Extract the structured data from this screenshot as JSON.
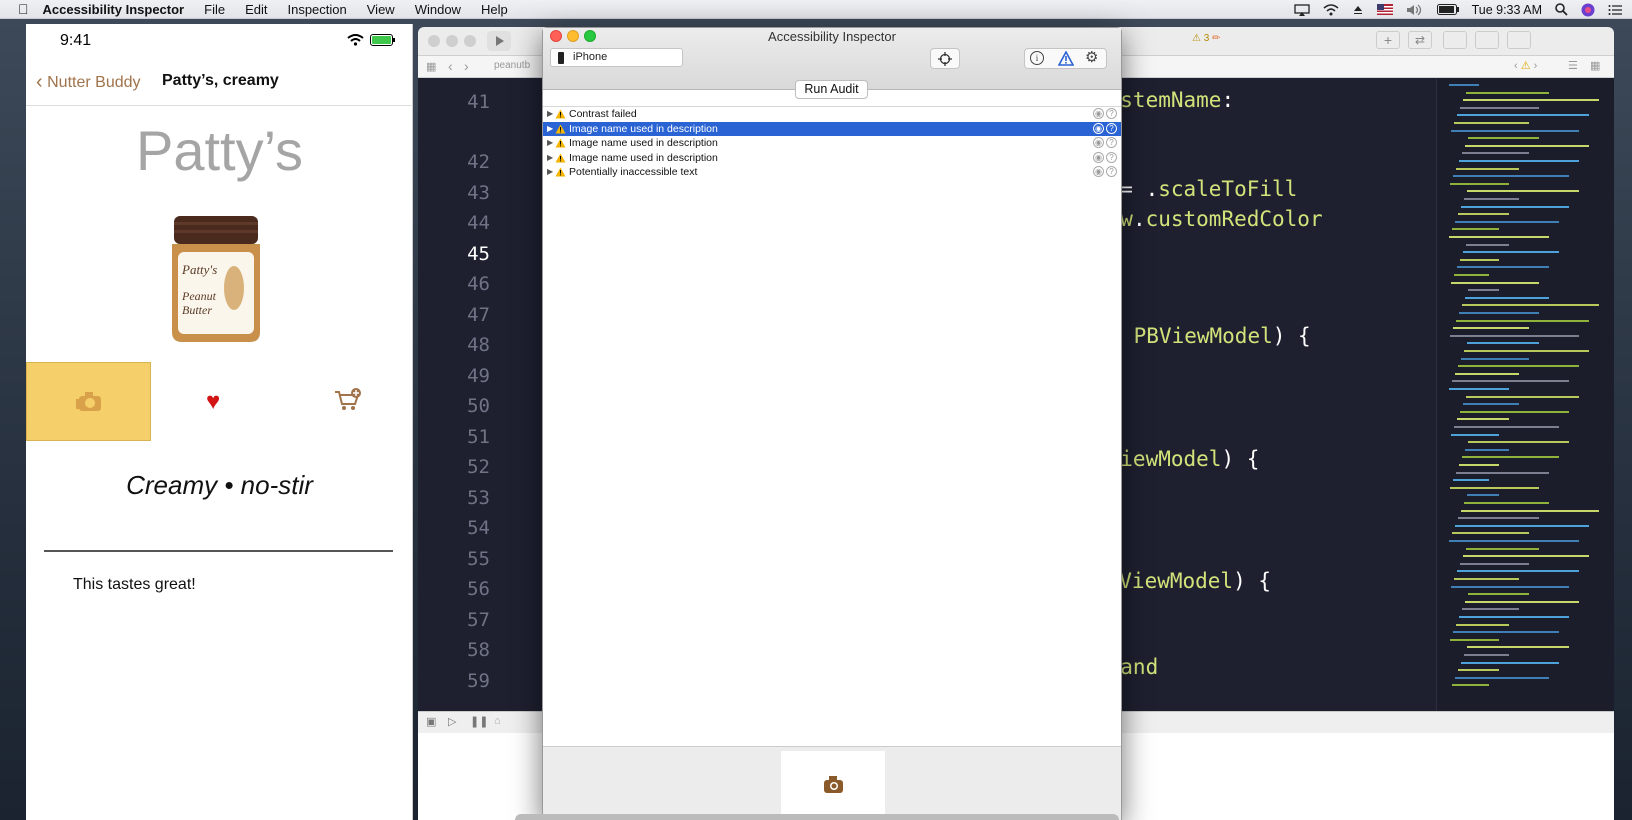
{
  "menubar": {
    "app_name": "Accessibility Inspector",
    "menus": [
      "File",
      "Edit",
      "Inspection",
      "View",
      "Window",
      "Help"
    ],
    "clock": "Tue 9:33 AM"
  },
  "phone": {
    "time": "9:41",
    "back_label": "Nutter Buddy",
    "nav_title": "Patty’s, creamy",
    "brand": "Patty’s",
    "jar_label_lines": [
      "Patty's",
      "Peanut",
      "Butter"
    ],
    "description": "Creamy • no-stir",
    "review": "This tastes great!"
  },
  "xcode": {
    "warning_count": "3",
    "jump_label": "peanutb",
    "line_numbers": [
      "41",
      "",
      "42",
      "43",
      "44",
      "45",
      "46",
      "47",
      "48",
      "49",
      "50",
      "51",
      "52",
      "53",
      "54",
      "55",
      "56",
      "57",
      "58",
      "59"
    ],
    "current_line": "45",
    "code_lines": [
      {
        "text": "systemName:"
      },
      {
        "text": "e = .scaleToFill"
      },
      {
        "text": "iew.customRedColor"
      },
      {
        "text": " PBViewModel) {"
      },
      {
        "text": "BViewModel) {"
      },
      {
        "text": "PBViewModel) {"
      },
      {
        "text": "brand"
      }
    ]
  },
  "inspector": {
    "title": "Accessibility Inspector",
    "device": "iPhone",
    "run_audit": "Run Audit",
    "audit_items": [
      {
        "label": "Contrast failed",
        "selected": false
      },
      {
        "label": "Image name used in description",
        "selected": true
      },
      {
        "label": "Image name used in description",
        "selected": false
      },
      {
        "label": "Image name used in description",
        "selected": false
      },
      {
        "label": "Potentially inaccessible text",
        "selected": false
      }
    ]
  },
  "colors": {
    "accent_yellow": "#f5cf6a",
    "selection_blue": "#2a63d4",
    "heart_red": "#d21414",
    "code_keyword": "#d3e37a",
    "editor_bg": "#1e2030"
  }
}
